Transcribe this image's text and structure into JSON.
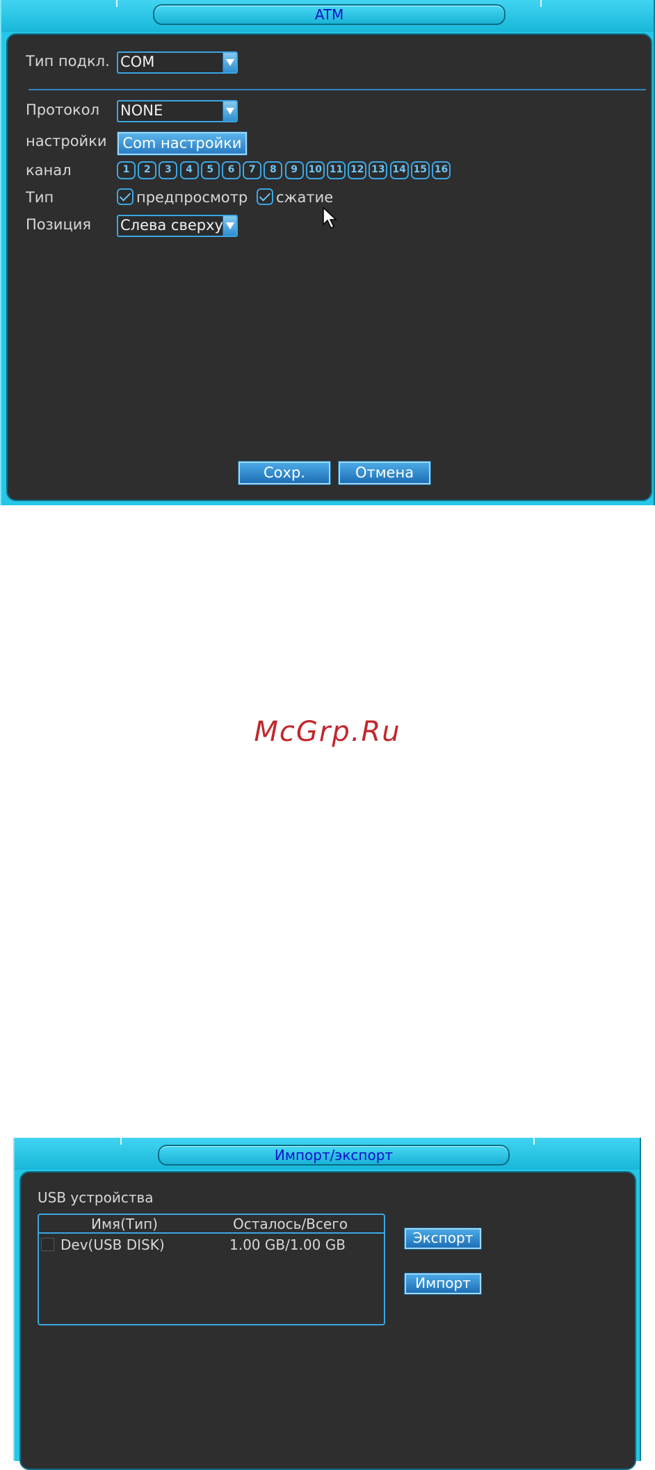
{
  "atm_dialog": {
    "title": "ATM",
    "conn_type_label": "Тип подкл.",
    "conn_type_value": "COM",
    "protocol_label": "Протокол",
    "protocol_value": "NONE",
    "settings_label": "настройки",
    "settings_button": "Com настройки",
    "channel_label": "канал",
    "channels": [
      "1",
      "2",
      "3",
      "4",
      "5",
      "6",
      "7",
      "8",
      "9",
      "10",
      "11",
      "12",
      "13",
      "14",
      "15",
      "16"
    ],
    "type_label": "Тип",
    "preview_label": "предпросмотр",
    "preview_checked": true,
    "compress_label": "сжатие",
    "compress_checked": true,
    "position_label": "Позиция",
    "position_value": "Слева сверху",
    "save_button": "Сохр.",
    "cancel_button": "Отмена"
  },
  "watermark": "McGrp.Ru",
  "export_dialog": {
    "title": "Импорт/экспорт",
    "usb_label": "USB устройства",
    "columns": [
      "Имя(Тип)",
      "Осталось/Всего"
    ],
    "rows": [
      {
        "name": "Dev(USB DISK)",
        "space": "1.00 GB/1.00 GB",
        "checked": false
      }
    ],
    "export_button": "Экспорт",
    "import_button": "Импорт"
  },
  "colors": {
    "frame": "#27c6e6",
    "panel": "#2e2e2e",
    "accent": "#3aa7e4",
    "title_text": "#1010c8",
    "watermark": "#c0282e"
  }
}
